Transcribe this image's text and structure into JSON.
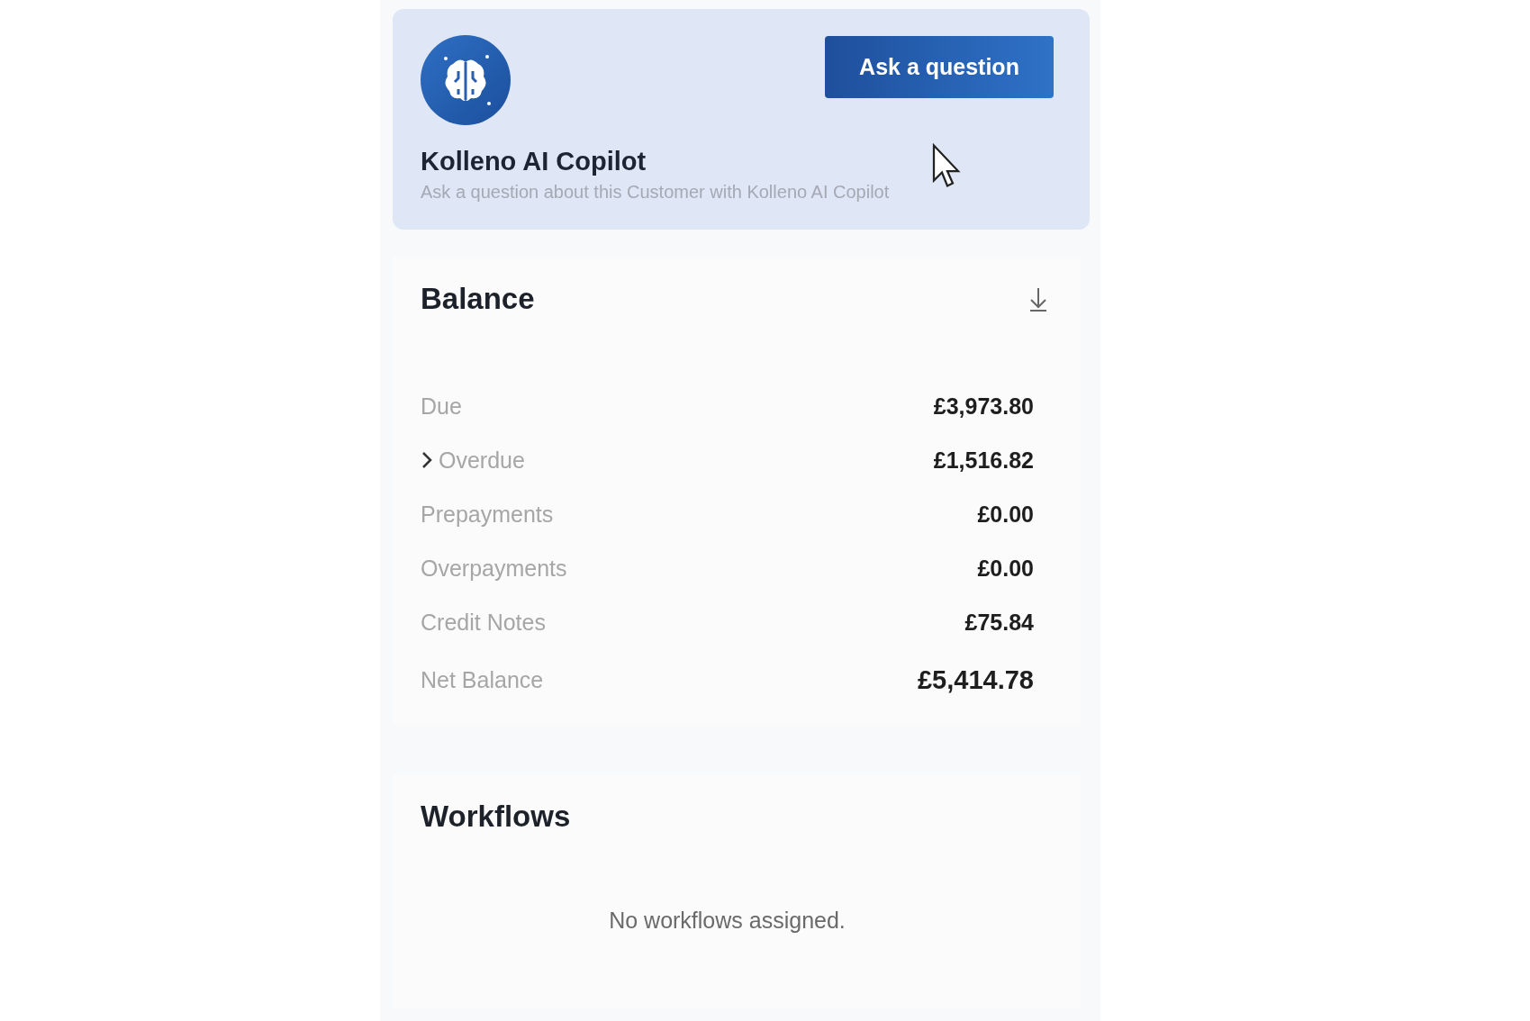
{
  "copilot": {
    "button": "Ask a question",
    "title": "Kolleno AI Copilot",
    "subtitle": "Ask a question about this Customer with Kolleno AI Copilot"
  },
  "balance": {
    "title": "Balance",
    "rows": [
      {
        "kind": "plain",
        "label": "Due",
        "value": "£3,973.80"
      },
      {
        "kind": "expandable",
        "label": "Overdue",
        "value": "£1,516.82"
      },
      {
        "kind": "plain",
        "label": "Prepayments",
        "value": "£0.00"
      },
      {
        "kind": "plain",
        "label": "Overpayments",
        "value": "£0.00"
      },
      {
        "kind": "plain",
        "label": "Credit Notes",
        "value": "£75.84"
      },
      {
        "kind": "total",
        "label": "Net Balance",
        "value": "£5,414.78"
      }
    ]
  },
  "workflows": {
    "title": "Workflows",
    "empty_message": "No workflows assigned."
  }
}
